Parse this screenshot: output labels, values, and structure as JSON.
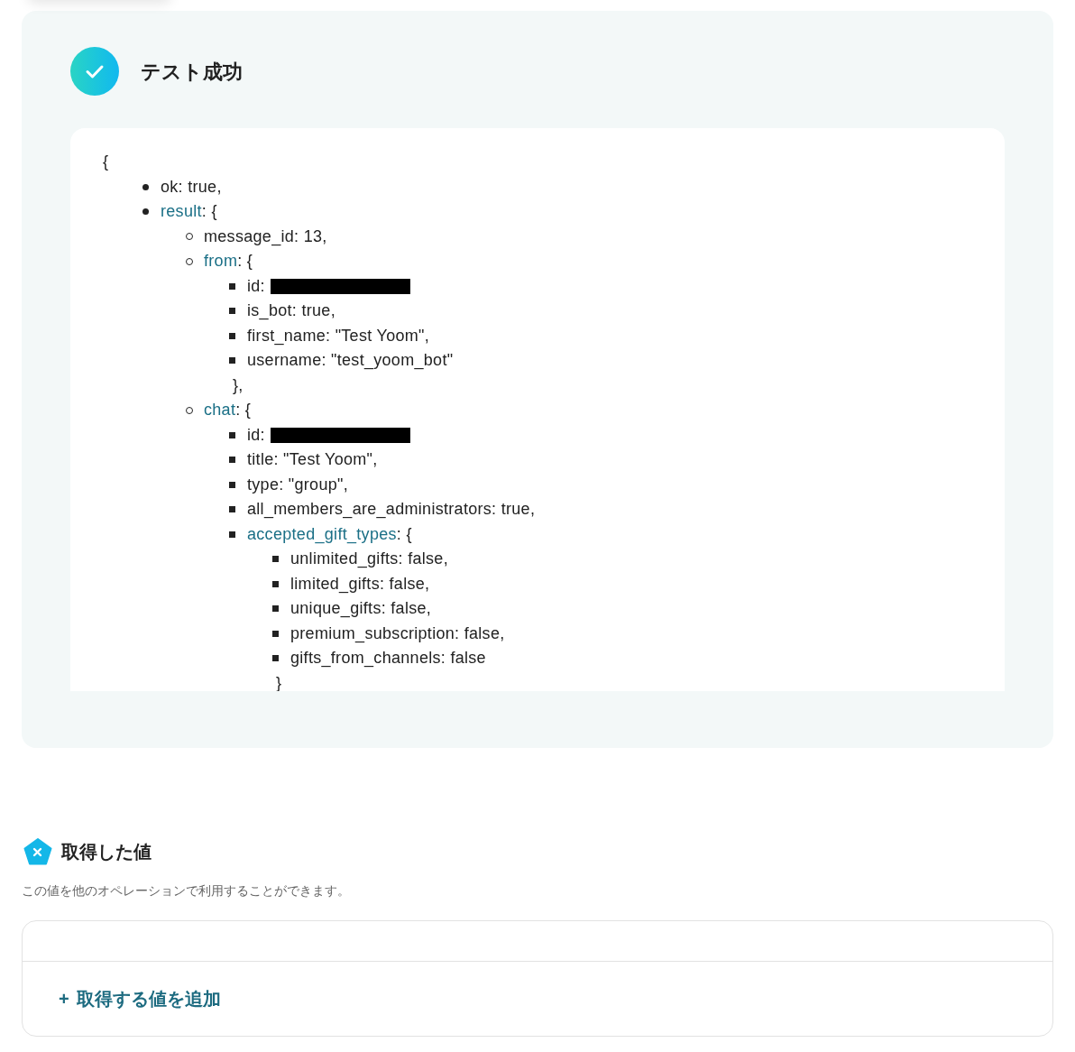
{
  "result_panel": {
    "title": "テスト成功",
    "open": "{",
    "items": [
      {
        "kind": "value",
        "text": "ok: true,"
      },
      {
        "kind": "object",
        "key": "result",
        "text": ": {",
        "children": [
          {
            "kind": "value",
            "text": "message_id: 13,"
          },
          {
            "kind": "object",
            "key": "from",
            "text": ": {",
            "close": "},",
            "children": [
              {
                "kind": "redacted",
                "text": "id:"
              },
              {
                "kind": "value",
                "text": "is_bot: true,"
              },
              {
                "kind": "value",
                "text": "first_name: \"Test Yoom\","
              },
              {
                "kind": "value",
                "text": "username: \"test_yoom_bot\""
              }
            ]
          },
          {
            "kind": "object",
            "key": "chat",
            "text": ": {",
            "children": [
              {
                "kind": "redacted",
                "text": "id:"
              },
              {
                "kind": "value",
                "text": "title: \"Test Yoom\","
              },
              {
                "kind": "value",
                "text": "type: \"group\","
              },
              {
                "kind": "value",
                "text": "all_members_are_administrators: true,"
              },
              {
                "kind": "object",
                "key": "accepted_gift_types",
                "text": ": {",
                "close": "}",
                "children": [
                  {
                    "kind": "value",
                    "text": "unlimited_gifts: false,"
                  },
                  {
                    "kind": "value",
                    "text": "limited_gifts: false,"
                  },
                  {
                    "kind": "value",
                    "text": "unique_gifts: false,"
                  },
                  {
                    "kind": "value",
                    "text": "premium_subscription: false,"
                  },
                  {
                    "kind": "value",
                    "text": "gifts_from_channels: false"
                  }
                ]
              }
            ]
          }
        ]
      }
    ]
  },
  "values_section": {
    "title": "取得した値",
    "description": "この値を他のオペレーションで利用することができます。",
    "add_button": {
      "icon": "+",
      "label": "取得する値を追加"
    }
  }
}
